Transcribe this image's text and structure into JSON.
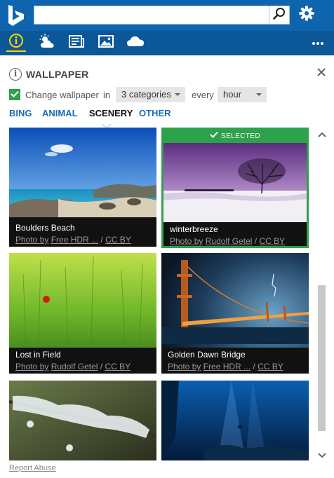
{
  "search": {
    "value": "",
    "placeholder": ""
  },
  "panel": {
    "title": "WALLPAPER",
    "change_label": "Change wallpaper",
    "in_label": "in",
    "categories_value": "3 categories",
    "every_label": "every",
    "interval_value": "hour"
  },
  "tabs": [
    "BING",
    "ANIMAL",
    "SCENERY",
    "OTHER"
  ],
  "active_tab": "SCENERY",
  "cards": [
    {
      "title": "Boulders Beach",
      "photo_by": "Photo by",
      "author": "Free HDR ...",
      "sep": "/",
      "license": "CC BY",
      "selected": false
    },
    {
      "title": "winterbreeze",
      "photo_by": "Photo by",
      "author": "Rudolf Getel",
      "sep": "/",
      "license": "CC BY",
      "selected": true,
      "selected_label": "SELECTED"
    },
    {
      "title": "Lost in Field",
      "photo_by": "Photo by",
      "author": "Rudolf Getel",
      "sep": "/",
      "license": "CC BY",
      "selected": false
    },
    {
      "title": "Golden Dawn Bridge",
      "photo_by": "Photo by",
      "author": "Free HDR ...",
      "sep": "/",
      "license": "CC BY",
      "selected": false
    }
  ],
  "footer": {
    "report_label": "Report Abuse"
  },
  "colors": {
    "brand_blue": "#0e64ad",
    "toolbar_blue": "#0c5798",
    "accent_green": "#2ca24b",
    "link_blue": "#1b6cb5"
  }
}
